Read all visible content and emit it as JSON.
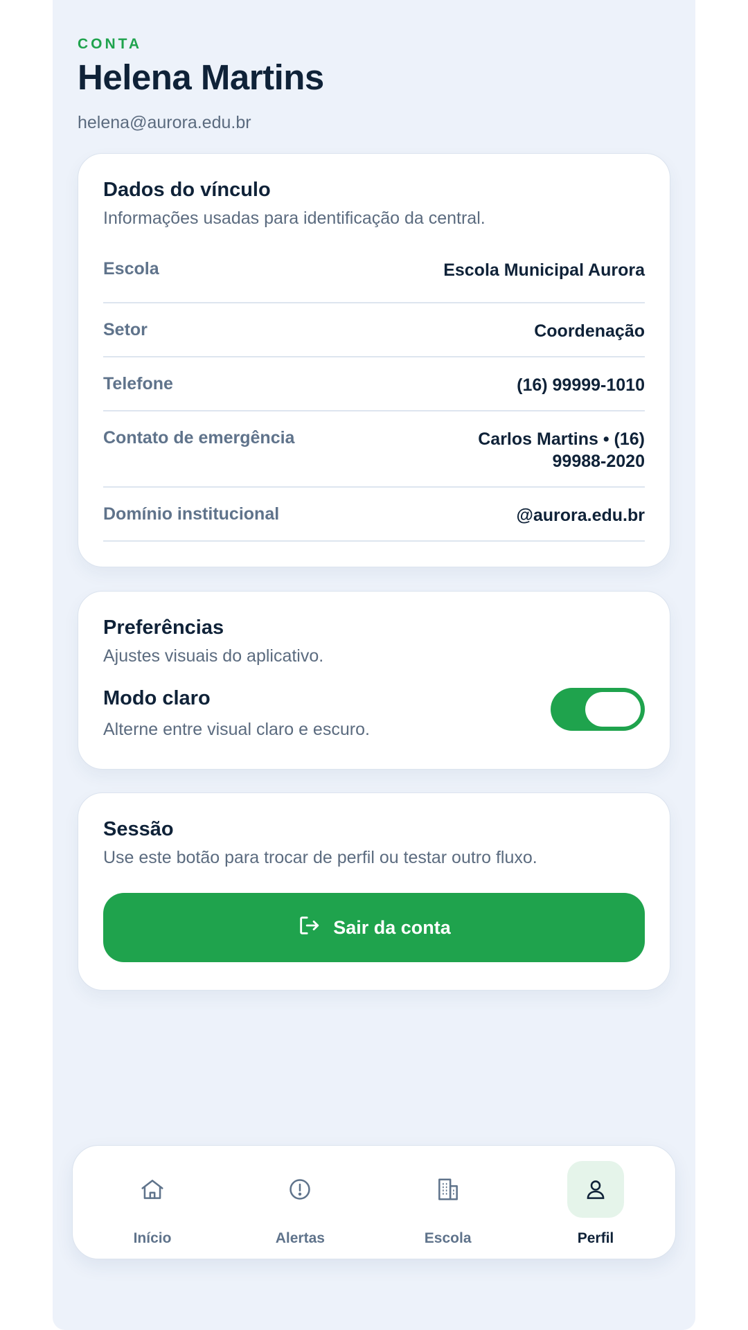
{
  "header": {
    "eyebrow": "CONTA",
    "name": "Helena Martins",
    "email": "helena@aurora.edu.br"
  },
  "vinculo": {
    "title": "Dados do vínculo",
    "subtitle": "Informações usadas para identificação da central.",
    "rows": [
      {
        "label": "Escola",
        "value": "Escola Municipal Aurora"
      },
      {
        "label": "Setor",
        "value": "Coordenação"
      },
      {
        "label": "Telefone",
        "value": "(16) 99999-1010"
      },
      {
        "label": "Contato de emergência",
        "value": "Carlos Martins • (16) 99988-2020"
      },
      {
        "label": "Domínio institucional",
        "value": "@aurora.edu.br"
      }
    ]
  },
  "preferencias": {
    "title": "Preferências",
    "subtitle": "Ajustes visuais do aplicativo.",
    "mode_title": "Modo claro",
    "mode_subtitle": "Alterne entre visual claro e escuro.",
    "toggle_on": true
  },
  "sessao": {
    "title": "Sessão",
    "subtitle": "Use este botão para trocar de perfil ou testar outro fluxo.",
    "logout_label": "Sair da conta"
  },
  "tabs": [
    {
      "label": "Início",
      "icon": "home-icon"
    },
    {
      "label": "Alertas",
      "icon": "alert-circle-icon"
    },
    {
      "label": "Escola",
      "icon": "building-icon"
    },
    {
      "label": "Perfil",
      "icon": "user-icon",
      "active": true
    }
  ],
  "colors": {
    "accent": "#1fa34d",
    "background": "#edf2fa",
    "text": "#0f2238",
    "muted": "#5f738b"
  }
}
